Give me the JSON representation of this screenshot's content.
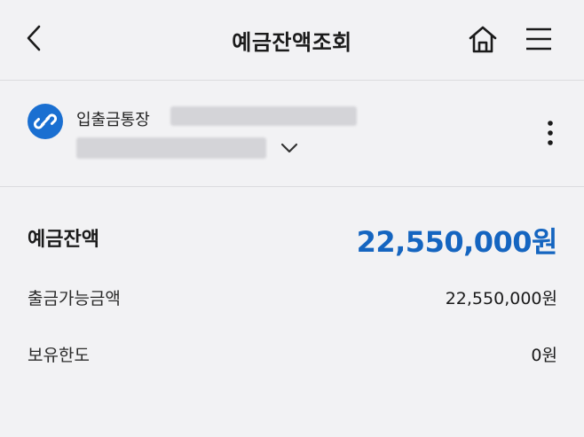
{
  "header": {
    "title": "예금잔액조회",
    "back_icon": "chevron-left-icon",
    "home_icon": "home-icon",
    "menu_icon": "hamburger-menu-icon"
  },
  "account": {
    "type_label": "입출금통장",
    "icon": "link-icon",
    "icon_color": "#1a6fd1",
    "expand_icon": "chevron-down-icon",
    "more_icon": "vertical-dots-icon"
  },
  "balance": {
    "label": "예금잔액",
    "value": "22,550,000원",
    "accent_color": "#1565c0"
  },
  "details": [
    {
      "label": "출금가능금액",
      "value": "22,550,000원"
    },
    {
      "label": "보유한도",
      "value": "0원"
    }
  ]
}
